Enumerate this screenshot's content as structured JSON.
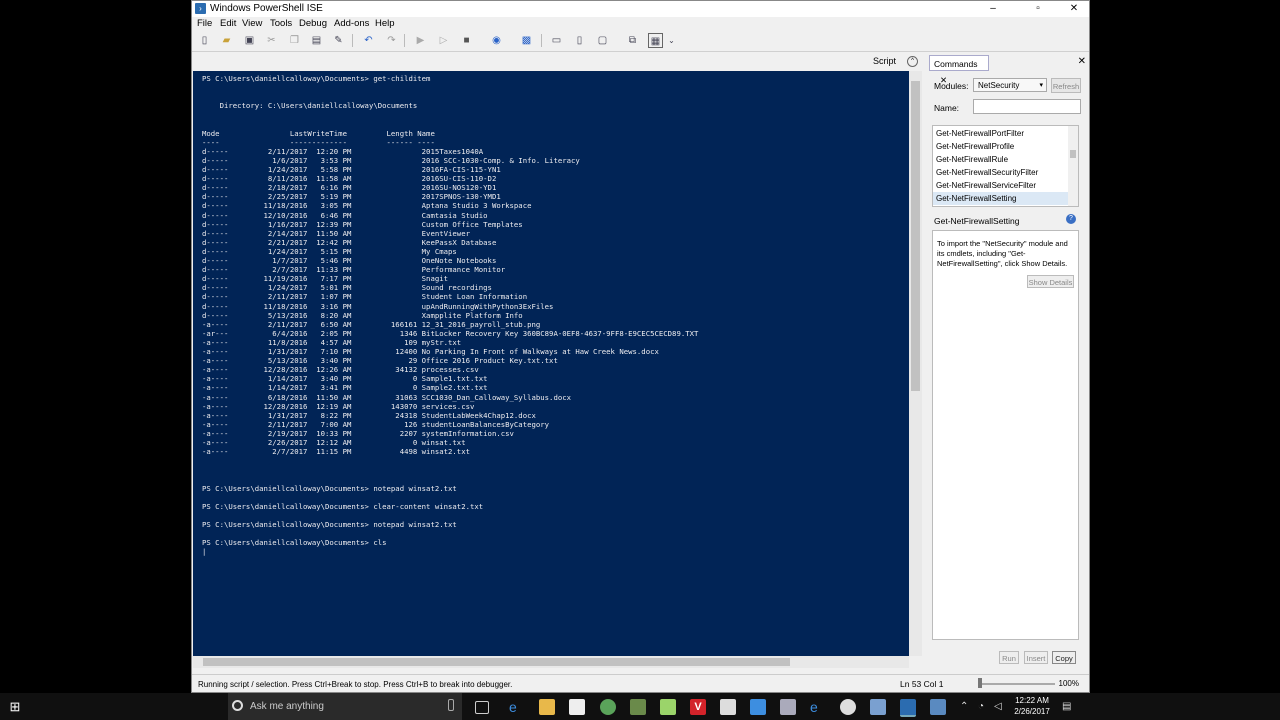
{
  "window": {
    "title": "Windows PowerShell ISE"
  },
  "menu": [
    "File",
    "Edit",
    "View",
    "Tools",
    "Debug",
    "Add-ons",
    "Help"
  ],
  "script_bar": {
    "label": "Script"
  },
  "console": {
    "lines": [
      "PS C:\\Users\\daniellcalloway\\Documents> get-childitem",
      "",
      "",
      "    Directory: C:\\Users\\daniellcalloway\\Documents",
      "",
      "",
      "Mode                LastWriteTime         Length Name",
      "----                -------------         ------ ----",
      "d-----         2/11/2017  12:20 PM                2015Taxes1040A",
      "d-----          1/6/2017   3:53 PM                2016 SCC-1030-Comp. & Info. Literacy",
      "d-----         1/24/2017   5:58 PM                2016FA-CIS-115-YN1",
      "d-----         8/11/2016  11:58 AM                2016SU-CIS-110-D2",
      "d-----         2/18/2017   6:16 PM                2016SU-NOS120-YD1",
      "d-----         2/25/2017   5:19 PM                2017SPNOS-130-YMD1",
      "d-----        11/18/2016   3:05 PM                Aptana Studio 3 Workspace",
      "d-----        12/10/2016   6:46 PM                Camtasia Studio",
      "d-----         1/16/2017  12:39 PM                Custom Office Templates",
      "d-----         2/14/2017  11:50 AM                EventViewer",
      "d-----         2/21/2017  12:42 PM                KeePassX Database",
      "d-----         1/24/2017   5:15 PM                My Cmaps",
      "d-----          1/7/2017   5:46 PM                OneNote Notebooks",
      "d-----          2/7/2017  11:33 PM                Performance Monitor",
      "d-----        11/19/2016   7:17 PM                Snagit",
      "d-----         1/24/2017   5:01 PM                Sound recordings",
      "d-----         2/11/2017   1:07 PM                Student Loan Information",
      "d-----        11/18/2016   3:16 PM                upAndRunningWithPython3ExFiles",
      "d-----         5/13/2016   8:20 AM                Xampplite Platform Info",
      "-a----         2/11/2017   6:50 AM         166161 12_31_2016_payroll_stub.png",
      "-ar---          6/4/2016   2:05 PM           1346 BitLocker Recovery Key 360BC89A-0EF8-4637-9FF8-E9CEC5CECD89.TXT",
      "-a----         11/8/2016   4:57 AM            109 myStr.txt",
      "-a----         1/31/2017   7:10 PM          12400 No Parking In Front of Walkways at Haw Creek News.docx",
      "-a----         5/13/2016   3:40 PM             29 Office 2016 Product Key.txt.txt",
      "-a----        12/28/2016  12:26 AM          34132 processes.csv",
      "-a----         1/14/2017   3:40 PM              0 Sample1.txt.txt",
      "-a----         1/14/2017   3:41 PM              0 Sample2.txt.txt",
      "-a----         6/18/2016  11:50 AM          31063 SCC1030_Dan_Calloway_Syllabus.docx",
      "-a----        12/28/2016  12:19 AM         143070 services.csv",
      "-a----         1/31/2017   8:22 PM          24318 StudentLabWeek4Chap12.docx",
      "-a----         2/11/2017   7:00 AM            126 studentLoanBalancesByCategory",
      "-a----         2/19/2017  10:33 PM           2207 systemInformation.csv",
      "-a----         2/26/2017  12:12 AM              0 winsat.txt",
      "-a----          2/7/2017  11:15 PM           4498 winsat2.txt",
      "",
      "",
      "",
      "PS C:\\Users\\daniellcalloway\\Documents> notepad winsat2.txt",
      "",
      "PS C:\\Users\\daniellcalloway\\Documents> clear-content winsat2.txt",
      "",
      "PS C:\\Users\\daniellcalloway\\Documents> notepad winsat2.txt",
      "",
      "PS C:\\Users\\daniellcalloway\\Documents> cls",
      "|"
    ]
  },
  "commands_pane": {
    "tab_label": "Commands",
    "modules_label": "Modules:",
    "modules_value": "NetSecurity",
    "refresh_label": "Refresh",
    "name_label": "Name:",
    "name_value": "",
    "list": [
      "Get-NetFirewallPortFilter",
      "Get-NetFirewallProfile",
      "Get-NetFirewallRule",
      "Get-NetFirewallSecurityFilter",
      "Get-NetFirewallServiceFilter",
      "Get-NetFirewallSetting"
    ],
    "selected_command": "Get-NetFirewallSetting",
    "description": "To import the \"NetSecurity\" module and its cmdlets, including \"Get-NetFirewallSetting\", click Show Details.",
    "show_details_label": "Show Details",
    "run_label": "Run",
    "insert_label": "Insert",
    "copy_label": "Copy"
  },
  "status_bar": {
    "message": "Running script / selection.  Press Ctrl+Break to stop.  Press Ctrl+B to break into debugger.",
    "position": "Ln 53  Col 1",
    "zoom": "100%"
  },
  "taskbar": {
    "search_placeholder": "Ask me anything",
    "time": "12:22 AM",
    "date": "2/26/2017"
  },
  "colors": {
    "console_bg": "#012456",
    "console_fg": "#eeedf0",
    "taskbar_bg": "#101010"
  }
}
